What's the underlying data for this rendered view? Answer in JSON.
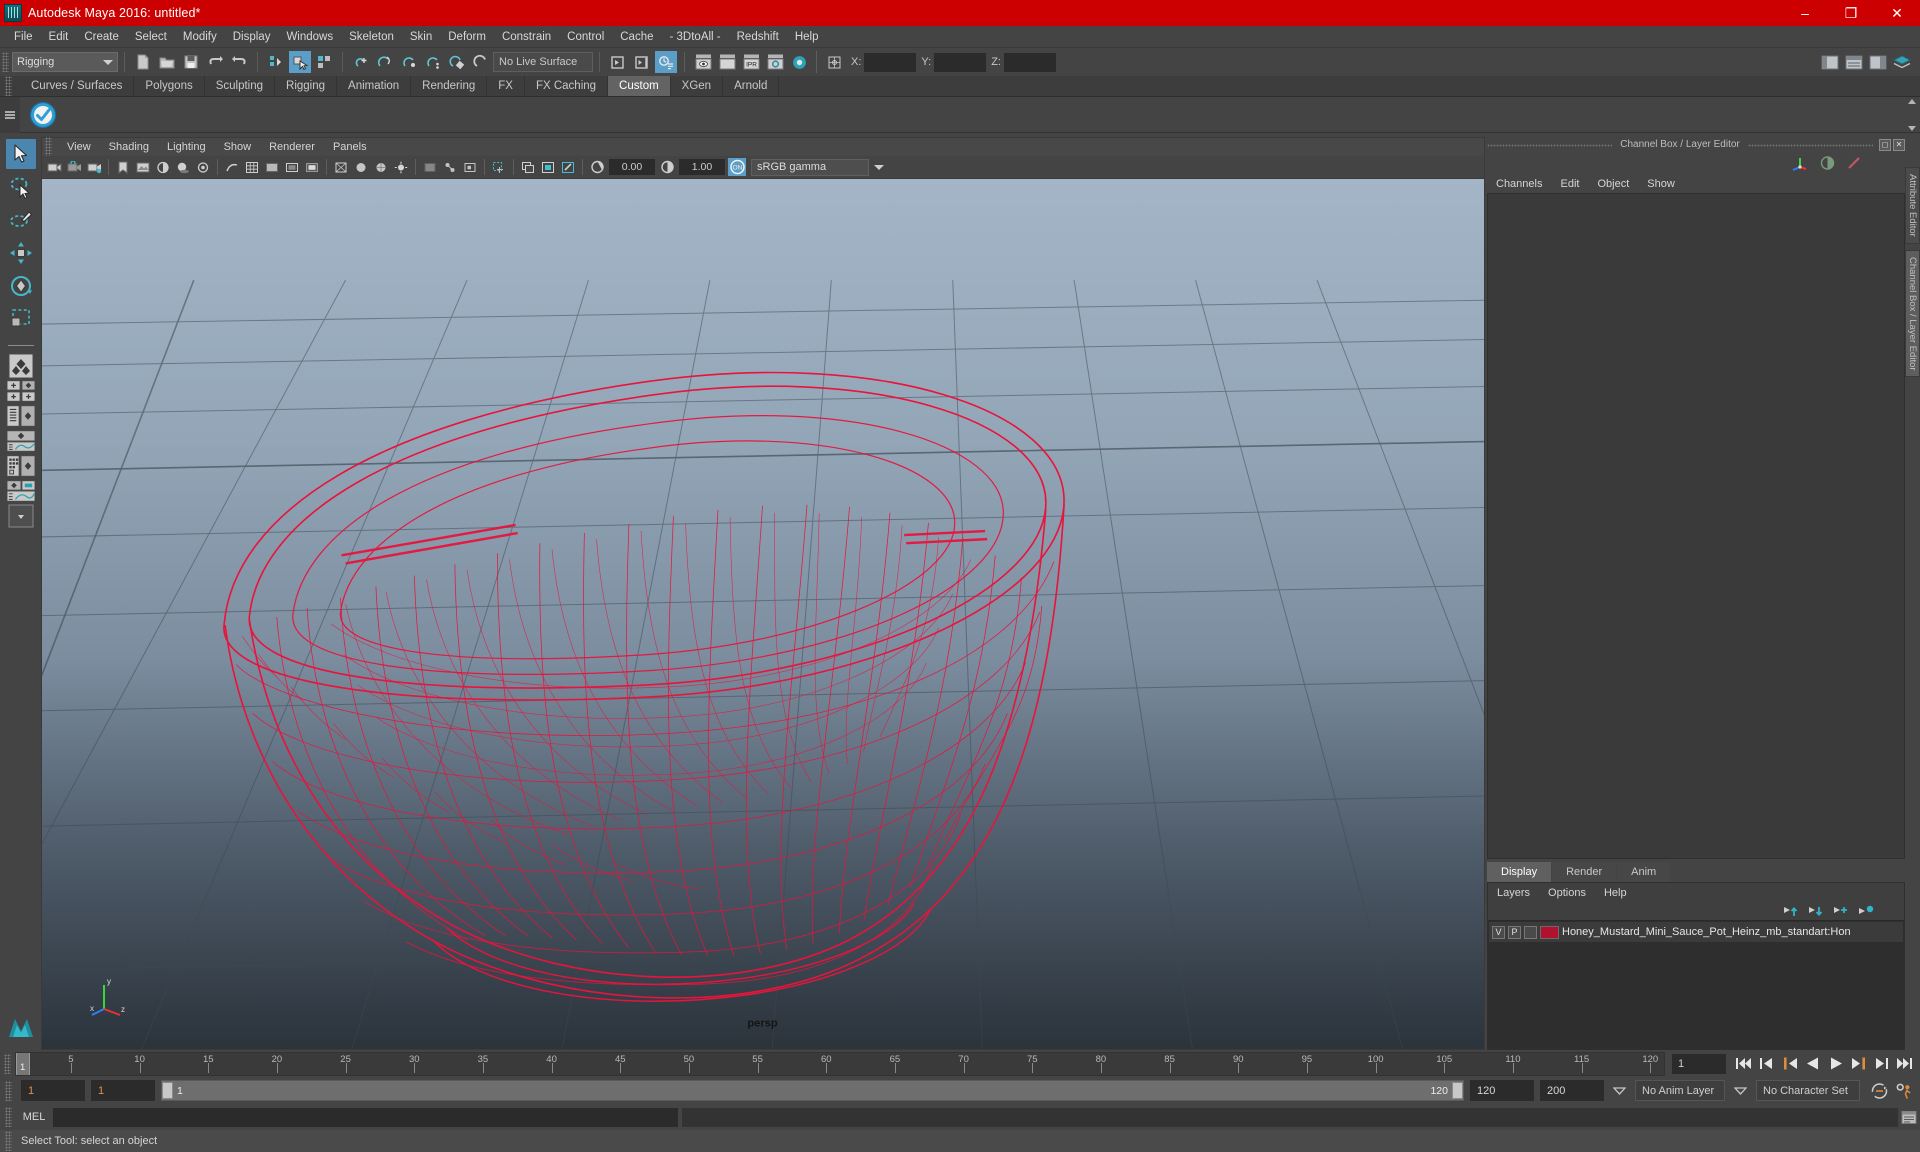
{
  "window": {
    "title": "Autodesk Maya 2016: untitled*",
    "logo_icon": "maya-app-icon",
    "controls": [
      {
        "name": "minimize-button",
        "glyph": "–"
      },
      {
        "name": "maximize-button",
        "glyph": "❐"
      },
      {
        "name": "close-button",
        "glyph": "✕"
      }
    ]
  },
  "menubar": {
    "items": [
      "File",
      "Edit",
      "Create",
      "Select",
      "Modify",
      "Display",
      "Windows",
      "Skeleton",
      "Skin",
      "Deform",
      "Constrain",
      "Control",
      "Cache",
      "- 3DtoAll -",
      "Redshift",
      "Help"
    ]
  },
  "statusline": {
    "menuset": "Rigging",
    "live_surface": "No Live Surface",
    "coord_x_label": "X:",
    "coord_y_label": "Y:",
    "coord_z_label": "Z:",
    "coord_x_value": "",
    "coord_y_value": "",
    "coord_z_value": "",
    "icons": [
      "new-scene-icon",
      "open-scene-icon",
      "save-scene-icon",
      "undo-icon",
      "redo-icon",
      "select-by-hierarchy-icon",
      "select-by-object-icon",
      "select-by-component-icon",
      "snap-grid-icon",
      "snap-curve-icon",
      "snap-point-icon",
      "snap-projected-center-icon",
      "snap-view-plane-icon",
      "make-live-icon",
      "open-render-view-icon",
      "render-current-frame-icon",
      "ipr-render-icon",
      "render-settings-icon",
      "hypershade-icon",
      "toggle-channelbox-icon",
      "toggle-layer-editor-icon",
      "toggle-attribute-editor-icon"
    ]
  },
  "shelf": {
    "tabs": [
      "Curves / Surfaces",
      "Polygons",
      "Sculpting",
      "Rigging",
      "Animation",
      "Rendering",
      "FX",
      "FX Caching",
      "Custom",
      "XGen",
      "Arnold"
    ],
    "active_tab": "Custom",
    "buttons": [
      "custom-checkmark-shelf-icon"
    ]
  },
  "toolbox": {
    "items": [
      {
        "name": "select-tool",
        "label": "Select Tool",
        "active": true
      },
      {
        "name": "lasso-select-tool",
        "label": "Lasso Select Tool",
        "active": false
      },
      {
        "name": "paint-select-tool",
        "label": "Paint Select Tool",
        "active": false
      },
      {
        "name": "move-tool",
        "label": "Move Tool",
        "active": false
      },
      {
        "name": "rotate-tool",
        "label": "Rotate Tool",
        "active": false
      },
      {
        "name": "scale-tool",
        "label": "Scale Tool",
        "active": false
      }
    ],
    "layouts": [
      {
        "name": "single-perspective-layout"
      },
      {
        "name": "four-view-layout"
      },
      {
        "name": "outliner-persp-layout"
      },
      {
        "name": "persp-graph-layout"
      },
      {
        "name": "hypershade-persp-layout"
      },
      {
        "name": "persp-graph-hypergraph-layout"
      },
      {
        "name": "layout-dropdown"
      }
    ],
    "logo": "maya-logo-icon"
  },
  "viewport": {
    "menus": [
      "View",
      "Shading",
      "Lighting",
      "Show",
      "Renderer",
      "Panels"
    ],
    "camera_label": "persp",
    "toolbar": {
      "exposure_value": "0.00",
      "gamma_value": "1.00",
      "color_profile": "sRGB gamma",
      "toggle_label": "ON",
      "icons": [
        "select-camera-icon",
        "lock-camera-icon",
        "camera-attributes-icon",
        "bookmark-icon",
        "image-plane-icon",
        "two-sided-lighting-icon",
        "shadows-icon",
        "ambient-occlusion-icon",
        "motion-blur-icon",
        "grid-toggle-icon",
        "film-gate-icon",
        "resolution-gate-icon",
        "gate-mask-icon",
        "wireframe-on-shaded-icon",
        "xray-icon",
        "xray-joints-icon",
        "isolate-select-icon",
        "exposure-icon",
        "gamma-icon",
        "color-management-icon"
      ]
    },
    "model": {
      "name": "Honey Mustard Mini Sauce Pot",
      "wireframe_color": "#e8143c",
      "selected": true
    },
    "axis_gizmo": {
      "x_label": "x",
      "y_label": "y",
      "z_label": "z"
    }
  },
  "channelbox": {
    "dock_title": "Channel Box / Layer Editor",
    "menus": [
      "Channels",
      "Edit",
      "Object",
      "Show"
    ],
    "icons": [
      "channel-box-icon",
      "attribute-editor-icon",
      "show-manipulator-icon"
    ],
    "content": ""
  },
  "layer_editor": {
    "tabs": [
      "Display",
      "Render",
      "Anim"
    ],
    "active_tab": "Display",
    "menus": [
      "Layers",
      "Options",
      "Help"
    ],
    "buttons": [
      "move-layer-up-icon",
      "move-layer-down-icon",
      "new-layer-icon",
      "new-layer-from-selected-icon"
    ],
    "layers": [
      {
        "visibility": "V",
        "playback": "P",
        "type": "",
        "color": "#b0112f",
        "name": "Honey_Mustard_Mini_Sauce_Pot_Heinz_mb_standart:Hon"
      }
    ]
  },
  "vertical_tabs": [
    {
      "label": "Attribute Editor",
      "active": false
    },
    {
      "label": "Channel Box / Layer Editor",
      "active": true
    }
  ],
  "timeslider": {
    "ticks": [
      5,
      10,
      15,
      20,
      25,
      30,
      35,
      40,
      45,
      50,
      55,
      60,
      65,
      70,
      75,
      80,
      85,
      90,
      95,
      100,
      105,
      110,
      115,
      120
    ],
    "start": 1,
    "end": 120,
    "current_frame": "1",
    "current_frame_field": "1",
    "playback_buttons": [
      "go-to-start-icon",
      "step-back-frame-icon",
      "step-back-key-icon",
      "play-backwards-icon",
      "play-forwards-icon",
      "step-forward-key-icon",
      "step-forward-frame-icon",
      "go-to-end-icon"
    ]
  },
  "rangeslider": {
    "anim_start": "1",
    "range_start": "1",
    "bar_start_label": "1",
    "bar_end_label": "120",
    "range_end": "120",
    "anim_end": "200",
    "anim_layer": "No Anim Layer",
    "character_set": "No Character Set",
    "icons": [
      "auto-key-icon",
      "animation-preferences-icon"
    ]
  },
  "commandline": {
    "language_label": "MEL",
    "input_value": "",
    "output_value": "",
    "script_editor_icon": "script-editor-icon"
  },
  "helpline": {
    "text": "Select Tool: select an object"
  }
}
